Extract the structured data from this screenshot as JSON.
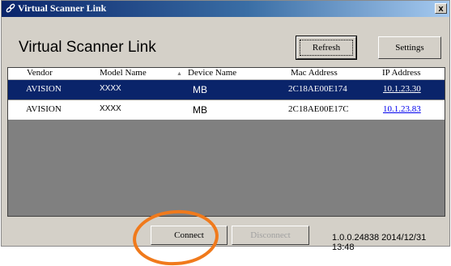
{
  "window": {
    "title": "Virtual Scanner Link",
    "close_label": "x"
  },
  "app_title": "Virtual Scanner Link",
  "toolbar": {
    "refresh_label": "Refresh",
    "settings_label": "Settings"
  },
  "table": {
    "headers": [
      "Vendor",
      "Model Name",
      "Device Name",
      "Mac Address",
      "IP Address"
    ],
    "sorted_column": "Device Name",
    "rows": [
      {
        "vendor": "AVISION",
        "model": "XXXX",
        "device": "MB",
        "mac": "2C18AE00E174",
        "ip": "10.1.23.30",
        "selected": true
      },
      {
        "vendor": "AVISION",
        "model": "XXXX",
        "device": "MB",
        "mac": "2C18AE00E17C",
        "ip": "10.1.23.83",
        "selected": false
      }
    ]
  },
  "footer": {
    "connect_label": "Connect",
    "disconnect_label": "Disconnect",
    "version_text": "1.0.0.24838  2014/12/31 13:48"
  },
  "colors": {
    "selection": "#0a246a",
    "highlight_circle": "#f07a1c",
    "link": "#0000ee"
  }
}
